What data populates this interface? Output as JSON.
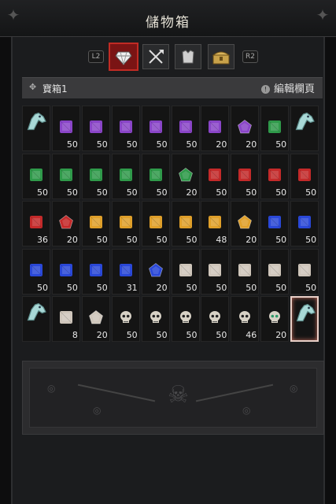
{
  "window": {
    "title": "儲物箱"
  },
  "tabs": {
    "left_hint": "L2",
    "right_hint": "R2",
    "items": [
      {
        "name": "gem-tab",
        "icon": "gem-icon",
        "active": true
      },
      {
        "name": "weapons-tab",
        "icon": "crossed-weapons-icon",
        "active": false
      },
      {
        "name": "armor-tab",
        "icon": "armor-icon",
        "active": false
      },
      {
        "name": "chest-tab",
        "icon": "treasure-chest-icon",
        "active": false
      }
    ]
  },
  "stash": {
    "name": "寶箱1",
    "edit_label": "編輯欄頁"
  },
  "grid": {
    "rows": [
      [
        {
          "type": "horse"
        },
        {
          "type": "amethyst",
          "count": "50"
        },
        {
          "type": "amethyst",
          "count": "50"
        },
        {
          "type": "amethyst",
          "count": "50"
        },
        {
          "type": "amethyst",
          "count": "50"
        },
        {
          "type": "amethyst",
          "count": "50"
        },
        {
          "type": "amethyst",
          "count": "20"
        },
        {
          "type": "amethyst-pent",
          "count": "20"
        },
        {
          "type": "emerald",
          "count": "50"
        },
        {
          "type": "horse"
        }
      ],
      [
        {
          "type": "emerald",
          "count": "50"
        },
        {
          "type": "emerald",
          "count": "50"
        },
        {
          "type": "emerald",
          "count": "50"
        },
        {
          "type": "emerald",
          "count": "50"
        },
        {
          "type": "emerald",
          "count": "50"
        },
        {
          "type": "emerald-pent",
          "count": "20"
        },
        {
          "type": "ruby",
          "count": "50"
        },
        {
          "type": "ruby",
          "count": "50"
        },
        {
          "type": "ruby",
          "count": "50"
        },
        {
          "type": "ruby",
          "count": "50"
        }
      ],
      [
        {
          "type": "ruby",
          "count": "36"
        },
        {
          "type": "ruby-pent",
          "count": "20"
        },
        {
          "type": "topaz",
          "count": "50"
        },
        {
          "type": "topaz",
          "count": "50"
        },
        {
          "type": "topaz",
          "count": "50"
        },
        {
          "type": "topaz",
          "count": "50"
        },
        {
          "type": "topaz",
          "count": "48"
        },
        {
          "type": "topaz-pent",
          "count": "20"
        },
        {
          "type": "sapphire",
          "count": "50"
        },
        {
          "type": "sapphire",
          "count": "50"
        }
      ],
      [
        {
          "type": "sapphire",
          "count": "50"
        },
        {
          "type": "sapphire",
          "count": "50"
        },
        {
          "type": "sapphire",
          "count": "50"
        },
        {
          "type": "sapphire",
          "count": "31"
        },
        {
          "type": "sapphire-pent",
          "count": "20"
        },
        {
          "type": "diamond",
          "count": "50"
        },
        {
          "type": "diamond",
          "count": "50"
        },
        {
          "type": "diamond",
          "count": "50"
        },
        {
          "type": "diamond",
          "count": "50"
        },
        {
          "type": "diamond",
          "count": "50"
        }
      ],
      [
        {
          "type": "horse"
        },
        {
          "type": "diamond",
          "count": "8"
        },
        {
          "type": "diamond-pent",
          "count": "20"
        },
        {
          "type": "skull",
          "count": "50"
        },
        {
          "type": "skull",
          "count": "50"
        },
        {
          "type": "skull",
          "count": "50"
        },
        {
          "type": "skull",
          "count": "50"
        },
        {
          "type": "skull",
          "count": "46"
        },
        {
          "type": "skull-green",
          "count": "20"
        },
        {
          "type": "horse",
          "selected": true
        }
      ]
    ]
  },
  "colors": {
    "amethyst": "#8a45c8",
    "emerald": "#2f9a4a",
    "ruby": "#c42a2a",
    "topaz": "#e0a02a",
    "sapphire": "#2a48d8",
    "diamond": "#cfc6bb",
    "skull": "#d8d2c6",
    "horse": "#a8d8d6",
    "accent": "#b01e1a"
  }
}
